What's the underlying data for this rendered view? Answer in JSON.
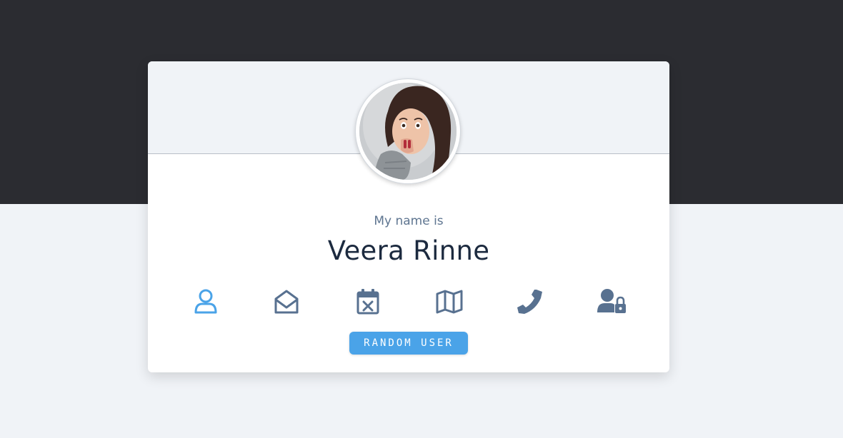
{
  "profile": {
    "label": "My name is",
    "name": "Veera Rinne",
    "avatar_alt": "portrait photo"
  },
  "icons": [
    {
      "name": "user-icon",
      "active": true
    },
    {
      "name": "envelope-open-icon",
      "active": false
    },
    {
      "name": "calendar-x-icon",
      "active": false
    },
    {
      "name": "map-icon",
      "active": false
    },
    {
      "name": "phone-icon",
      "active": false
    },
    {
      "name": "user-lock-icon",
      "active": false
    }
  ],
  "button": {
    "label": "RANDOM USER"
  },
  "colors": {
    "dark_band": "#2b2c31",
    "page_background": "#f0f3f7",
    "accent": "#4aa3e8",
    "icon_inactive": "#587190",
    "name_text": "#1c2a3f"
  }
}
